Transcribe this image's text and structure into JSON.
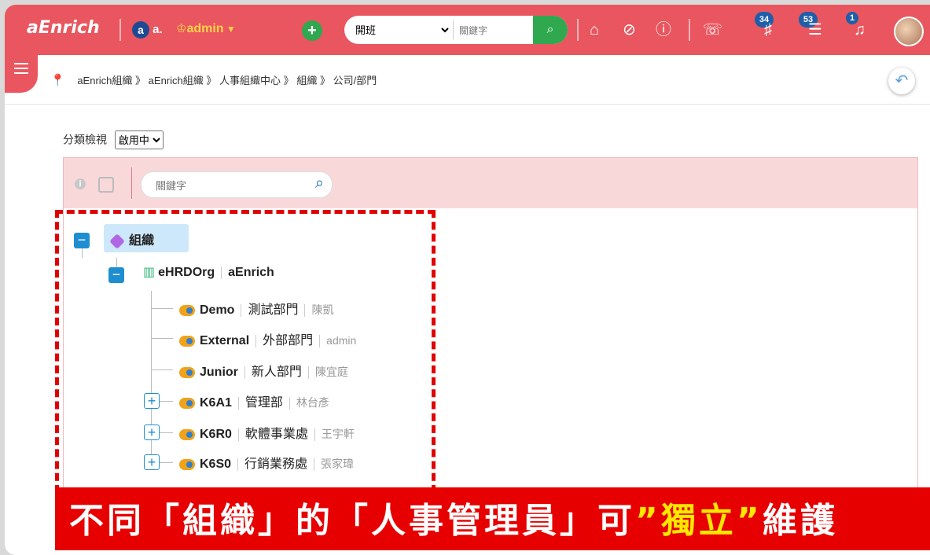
{
  "header": {
    "logo": "aEnrich",
    "org_short": "a.",
    "user_name": "admin",
    "search_category": "開班",
    "search_placeholder": "關鍵字",
    "badges": {
      "learning": "34",
      "tasks": "53",
      "notifications": "1"
    }
  },
  "breadcrumb": {
    "items": [
      "aEnrich組織",
      "aEnrich組織",
      "人事組織中心",
      "組織",
      "公司/部門"
    ],
    "sep": "》"
  },
  "view": {
    "label": "分類檢視",
    "selected": "啟用中"
  },
  "panel": {
    "search_placeholder": "關鍵字"
  },
  "tree": {
    "root": "組織",
    "company": {
      "code": "eHRDOrg",
      "name": "aEnrich"
    },
    "departments": [
      {
        "code": "Demo",
        "name": "測試部門",
        "manager": "陳凱",
        "expandable": false
      },
      {
        "code": "External",
        "name": "外部部門",
        "manager": "admin",
        "expandable": false
      },
      {
        "code": "Junior",
        "name": "新人部門",
        "manager": "陳宜庭",
        "expandable": false
      },
      {
        "code": "K6A1",
        "name": "管理部",
        "manager": "林台彥",
        "expandable": true
      },
      {
        "code": "K6R0",
        "name": "軟體事業處",
        "manager": "王宇軒",
        "expandable": true
      },
      {
        "code": "K6S0",
        "name": "行銷業務處",
        "manager": "張家瑋",
        "expandable": true
      }
    ]
  },
  "banner": {
    "part1": "不同「組織」的「人事管理員」可",
    "part2": "”獨立”",
    "part3": "維護"
  },
  "colors": {
    "brand": "#e9565f",
    "accent_green": "#2fa84f",
    "tree_blue": "#1e8ed0",
    "banner_red": "#e60000"
  }
}
